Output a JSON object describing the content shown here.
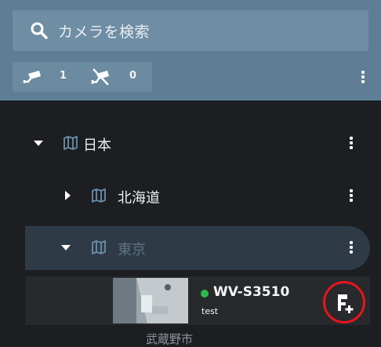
{
  "search": {
    "placeholder": "カメラを検索"
  },
  "status": {
    "online_count": "1",
    "offline_count": "0"
  },
  "tree": {
    "items": [
      {
        "label": "日本"
      },
      {
        "label": "北海道"
      },
      {
        "label": "東京"
      }
    ]
  },
  "camera": {
    "name": "WV-S3510",
    "tag": "test",
    "status_color": "#2fb84a"
  },
  "footer": {
    "partial_text": "武蔵野市"
  },
  "colors": {
    "header": "#5f7e95",
    "background": "#1c1e22",
    "highlight": "#e8141c",
    "online": "#2fb84a"
  }
}
